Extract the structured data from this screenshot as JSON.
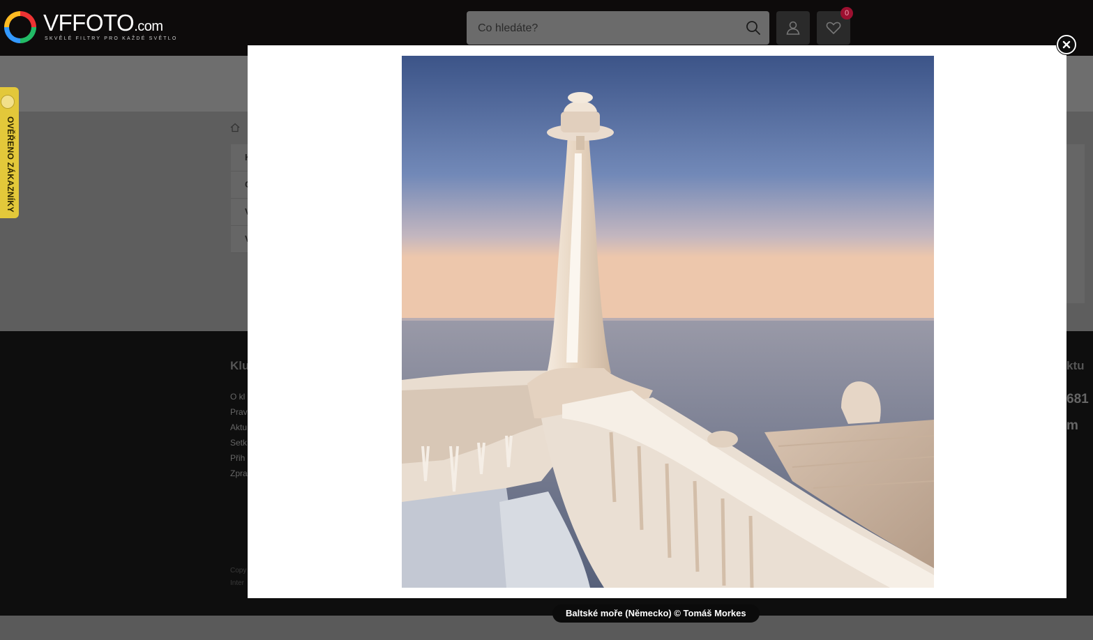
{
  "header": {
    "logo": {
      "brand": "VFFOTO",
      "domain": ".com",
      "tagline": "SKVĚLÉ FILTRY PRO KAŽDÉ SVĚTLO"
    },
    "search": {
      "placeholder": "Co hledáte?"
    },
    "wishlist": {
      "count": "0"
    }
  },
  "sidebar_rows": [
    "K",
    "C",
    "V",
    "V"
  ],
  "footer": {
    "column_title": "Klu",
    "links": [
      "O kl",
      "Prav",
      "Aktu",
      "Setk",
      "Přih",
      "Zpra"
    ],
    "copyright": [
      "Copy",
      "Inter"
    ],
    "right_title": "ktu",
    "right_line1": "681",
    "right_line2": "m"
  },
  "verified_badge": {
    "label": "OVĚŘENO ZÁKAZNÍKY"
  },
  "lightbox": {
    "caption": "Baltské moře (Německo) © Tomáš Morkes"
  },
  "colors": {
    "header_bg": "#0d0b0b",
    "badge": "#9c1030",
    "verified": "#e3c83a"
  }
}
